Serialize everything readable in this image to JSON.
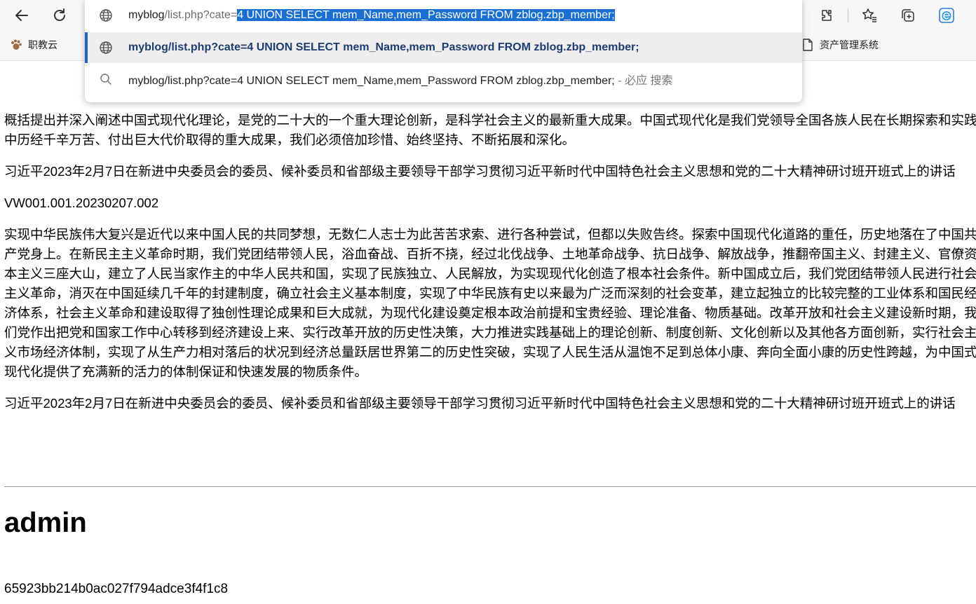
{
  "browser": {
    "address": {
      "host": "myblog",
      "path": "/list.php?cate=",
      "selected": "4 UNION SELECT mem_Name,mem_Password FROM zblog.zbp_member;"
    },
    "suggestions": [
      {
        "icon": "globe-icon",
        "text": "myblog/list.php?cate=4 UNION SELECT mem_Name,mem_Password FROM zblog.zbp_member;"
      },
      {
        "icon": "search-icon",
        "text": "myblog/list.php?cate=4 UNION SELECT mem_Name,mem_Password FROM zblog.zbp_member;",
        "suffix": " - 必应 搜索"
      }
    ],
    "bookmarks": [
      {
        "icon": "paw-icon",
        "label": "职教云"
      },
      {
        "icon": "document-icon",
        "label": "资产管理系统"
      }
    ],
    "accent": "#1a6fd1"
  },
  "page": {
    "paragraphs": [
      "概括提出并深入阐述中国式现代化理论，是党的二十大的一个重大理论创新，是科学社会主义的最新重大成果。中国式现代化是我们党领导全国各族人民在长期探索和实践中历经千辛万苦、付出巨大代价取得的重大成果，我们必须倍加珍惜、始终坚持、不断拓展和深化。",
      "习近平2023年2月7日在新进中央委员会的委员、候补委员和省部级主要领导干部学习贯彻习近平新时代中国特色社会主义思想和党的二十大精神研讨班开班式上的讲话",
      "VW001.001.20230207.002",
      "实现中华民族伟大复兴是近代以来中国人民的共同梦想，无数仁人志士为此苦苦求索、进行各种尝试，但都以失败告终。探索中国现代化道路的重任，历史地落在了中国共产党身上。在新民主主义革命时期，我们党团结带领人民，浴血奋战、百折不挠，经过北伐战争、土地革命战争、抗日战争、解放战争，推翻帝国主义、封建主义、官僚资本主义三座大山，建立了人民当家作主的中华人民共和国，实现了民族独立、人民解放，为实现现代化创造了根本社会条件。新中国成立后，我们党团结带领人民进行社会主义革命，消灭在中国延续几千年的封建制度，确立社会主义基本制度，实现了中华民族有史以来最为广泛而深刻的社会变革，建立起独立的比较完整的工业体系和国民经济体系，社会主义革命和建设取得了独创性理论成果和巨大成就，为现代化建设奠定根本政治前提和宝贵经验、理论准备、物质基础。改革开放和社会主义建设新时期，我们党作出把党和国家工作中心转移到经济建设上来、实行改革开放的历史性决策，大力推进实践基础上的理论创新、制度创新、文化创新以及其他各方面创新，实行社会主义市场经济体制，实现了从生产力相对落后的状况到经济总量跃居世界第二的历史性突破，实现了人民生活从温饱不足到总体小康、奔向全面小康的历史性跨越，为中国式现代化提供了充满新的活力的体制保证和快速发展的物质条件。",
      "习近平2023年2月7日在新进中央委员会的委员、候补委员和省部级主要领导干部学习贯彻习近平新时代中国特色社会主义思想和党的二十大精神研讨班开班式上的讲话"
    ],
    "heading": "admin",
    "hash": "65923bb214b0ac027f794adce3f4f1c8"
  }
}
